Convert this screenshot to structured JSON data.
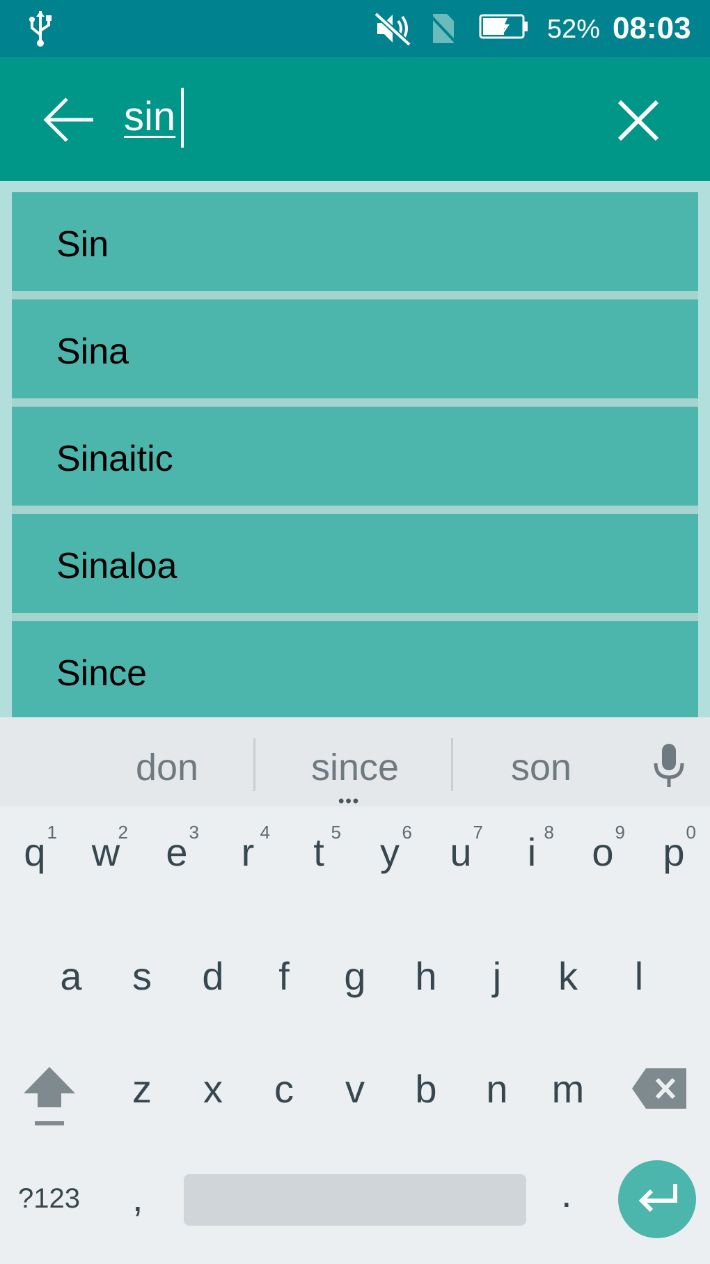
{
  "status_bar": {
    "battery_percent": "52%",
    "time": "08:03",
    "icons": [
      "usb-icon",
      "mute-icon",
      "no-sim-icon",
      "battery-charging-icon"
    ]
  },
  "toolbar": {
    "query": "sin",
    "icons": [
      "back-arrow-icon",
      "close-icon"
    ]
  },
  "results": [
    {
      "label": "Sin"
    },
    {
      "label": "Sina"
    },
    {
      "label": "Sinaitic"
    },
    {
      "label": "Sinaloa"
    },
    {
      "label": "Since"
    }
  ],
  "keyboard": {
    "suggestions": [
      "don",
      "since",
      "son"
    ],
    "row1": [
      {
        "ch": "q",
        "hint": "1"
      },
      {
        "ch": "w",
        "hint": "2"
      },
      {
        "ch": "e",
        "hint": "3"
      },
      {
        "ch": "r",
        "hint": "4"
      },
      {
        "ch": "t",
        "hint": "5"
      },
      {
        "ch": "y",
        "hint": "6"
      },
      {
        "ch": "u",
        "hint": "7"
      },
      {
        "ch": "i",
        "hint": "8"
      },
      {
        "ch": "o",
        "hint": "9"
      },
      {
        "ch": "p",
        "hint": "0"
      }
    ],
    "row2": [
      "a",
      "s",
      "d",
      "f",
      "g",
      "h",
      "j",
      "k",
      "l"
    ],
    "row3": [
      "z",
      "x",
      "c",
      "v",
      "b",
      "n",
      "m"
    ],
    "symbols_label": "?123",
    "comma_label": ",",
    "period_label": ".",
    "icons": [
      "mic-icon",
      "shift-icon",
      "backspace-icon",
      "enter-icon"
    ]
  },
  "colors": {
    "status_bar": "#00838f",
    "toolbar": "#009688",
    "result_row": "#4db6ac",
    "list_background": "#b2dfdb",
    "keyboard_background": "#eceff1",
    "enter_key": "#4db6ac"
  }
}
